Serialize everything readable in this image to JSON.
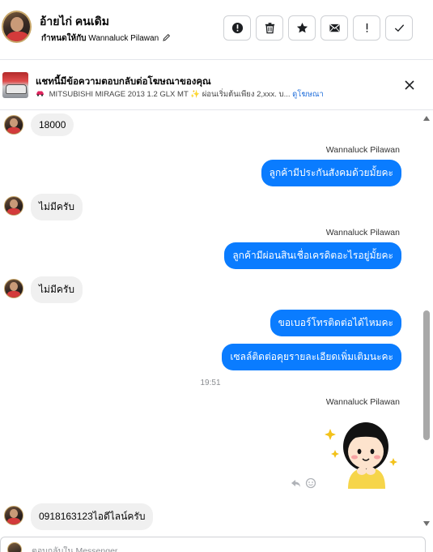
{
  "header": {
    "contact_name": "อ้ายไก่ คนเดิม",
    "assign_prefix": "กำหนดให้กับ",
    "assign_name": "Wannaluck Pilawan",
    "icons": [
      "info-icon",
      "trash-icon",
      "star-icon",
      "mail-icon",
      "exclamation-icon",
      "check-icon"
    ]
  },
  "ad": {
    "title": "แชทนี้มีข้อความตอบกลับต่อโฆษณาของคุณ",
    "description": "MITSUBISHI MIRAGE 2013 1.2 GLX MT",
    "description_tail": "ผ่อนเริ่มต้นเพียง 2,xxx. บ...",
    "link": "ดูโฆษณา"
  },
  "chat": {
    "messages": {
      "m1": "18000",
      "s1": "Wannaluck Pilawan",
      "m2": "ลูกค้ามีประกันสังคมด้วยมั้ยคะ",
      "m3": "ไม่มีครับ",
      "s2": "Wannaluck Pilawan",
      "m4": "ลูกค้ามีผ่อนสินเชื่อเครดิตอะไรอยู่มั้ยคะ",
      "m5": "ไม่มีครับ",
      "m6": "ขอเบอร์โทรติดต่อได้ไหมคะ",
      "m7": "เซลล์ติดต่อคุยรายละเอียดเพิ่มเติมนะคะ",
      "time": "19:51",
      "s3": "Wannaluck Pilawan",
      "m8": "0918163123ไอดีไลน์ครับ"
    }
  },
  "composer": {
    "placeholder": "ตอบกลับใน Messenger..."
  },
  "colors": {
    "outgoing_bubble": "#0a7cff",
    "incoming_bubble": "#f0f0f0"
  }
}
